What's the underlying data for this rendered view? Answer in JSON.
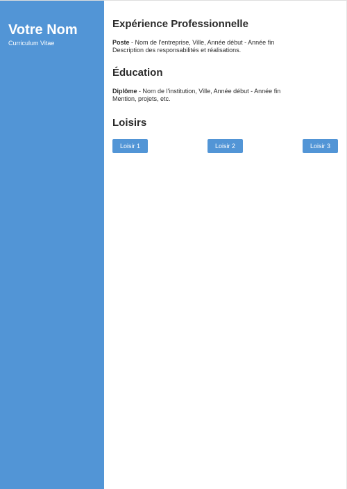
{
  "sidebar": {
    "name": "Votre Nom",
    "subtitle": "Curriculum Vitae"
  },
  "experience": {
    "title": "Expérience Professionnelle",
    "label": "Poste",
    "details": " - Nom de l'entreprise, Ville, Année début - Année fin",
    "description": "Description des responsabilités et réalisations."
  },
  "education": {
    "title": "Éducation",
    "label": "Diplôme",
    "details": " - Nom de l'institution, Ville, Année début - Année fin",
    "description": "Mention, projets, etc."
  },
  "hobbies": {
    "title": "Loisirs",
    "items": [
      "Loisir 1",
      "Loisir 2",
      "Loisir 3"
    ]
  },
  "colors": {
    "accent": "#5295d6",
    "text": "#2a2a2a"
  }
}
